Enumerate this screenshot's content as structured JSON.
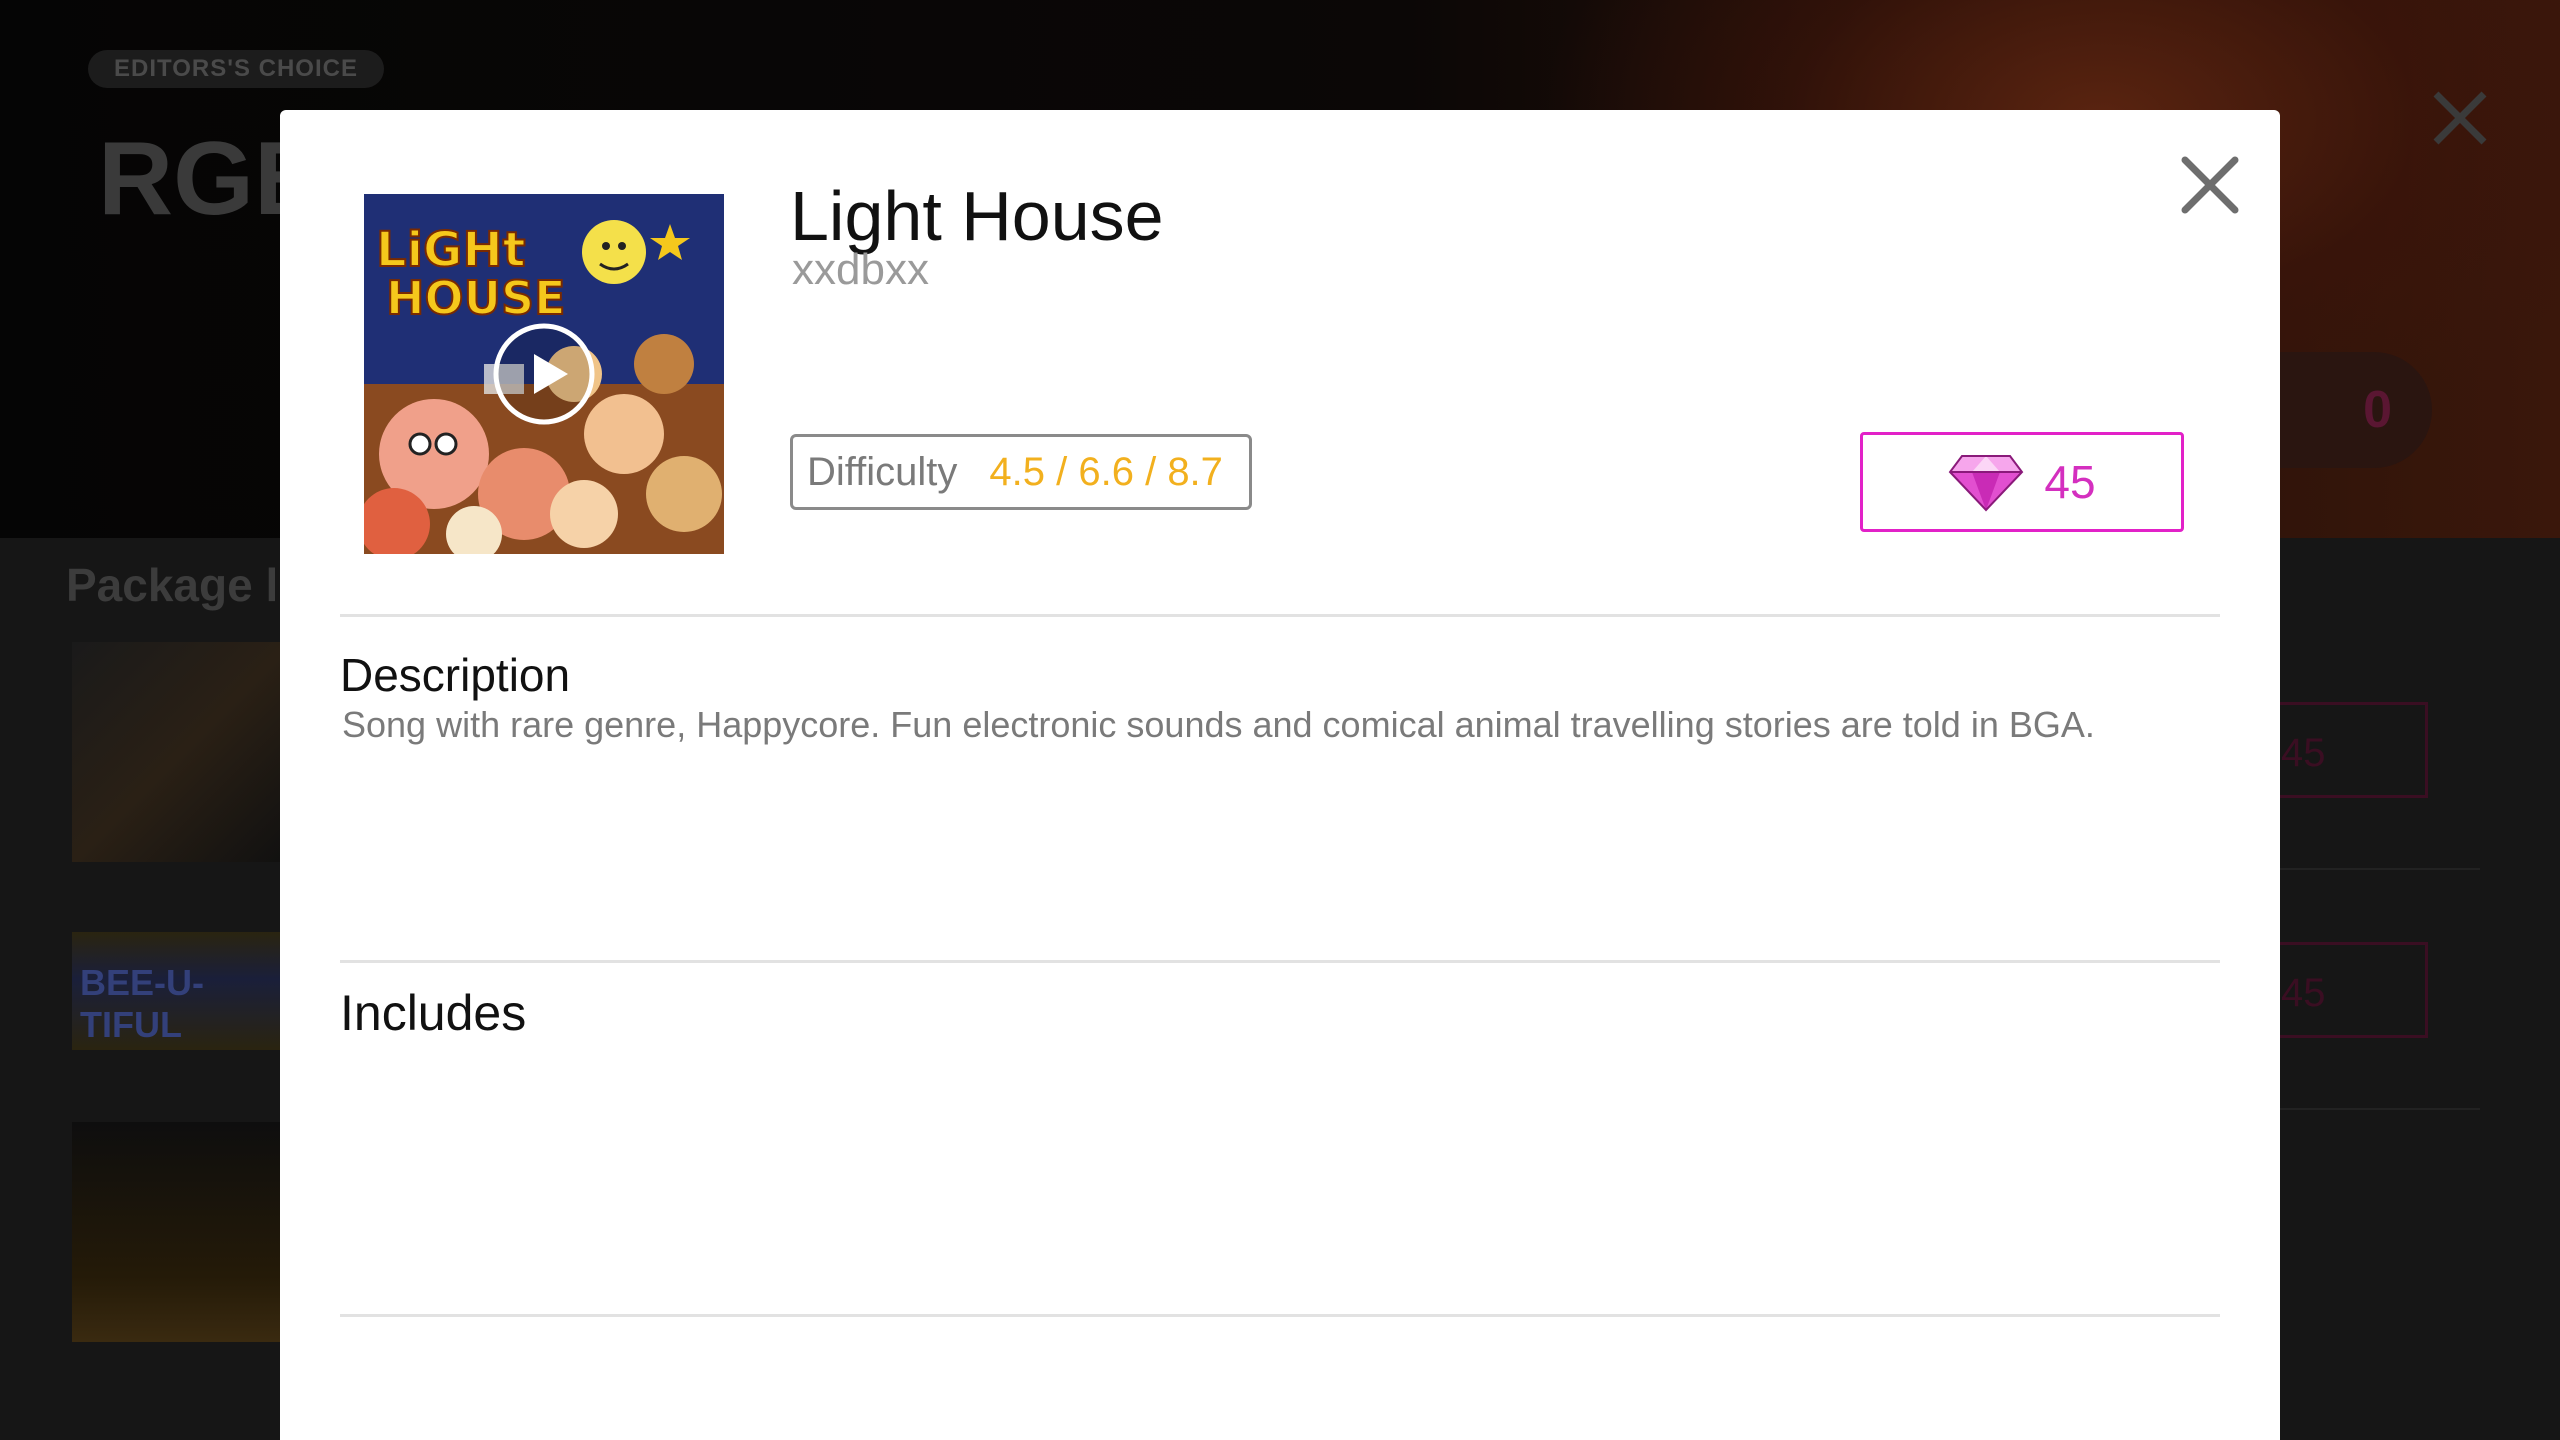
{
  "background": {
    "tag": "EDITORS'S CHOICE",
    "title": "RGB",
    "price_partial": "0",
    "section_title": "Package li",
    "thumb2_text": "BEE-U-TIFUL",
    "row_prices": [
      "45",
      "45"
    ]
  },
  "modal": {
    "song_title": "Light House",
    "artist": "xxdbxx",
    "difficulty": {
      "label": "Difficulty",
      "values": "4.5 / 6.6 / 8.7"
    },
    "price": {
      "amount": "45",
      "icon": "gem-icon"
    },
    "description_title": "Description",
    "description_text": "Song with rare genre, Happycore. Fun electronic sounds and comical animal travelling stories are told in BGA.",
    "includes_title": "Includes",
    "album_art_text": "LIGHT HOUSE"
  },
  "colors": {
    "accent_magenta": "#e221c8",
    "difficulty_values": "#f2b01e",
    "modal_bg": "#ffffff"
  }
}
